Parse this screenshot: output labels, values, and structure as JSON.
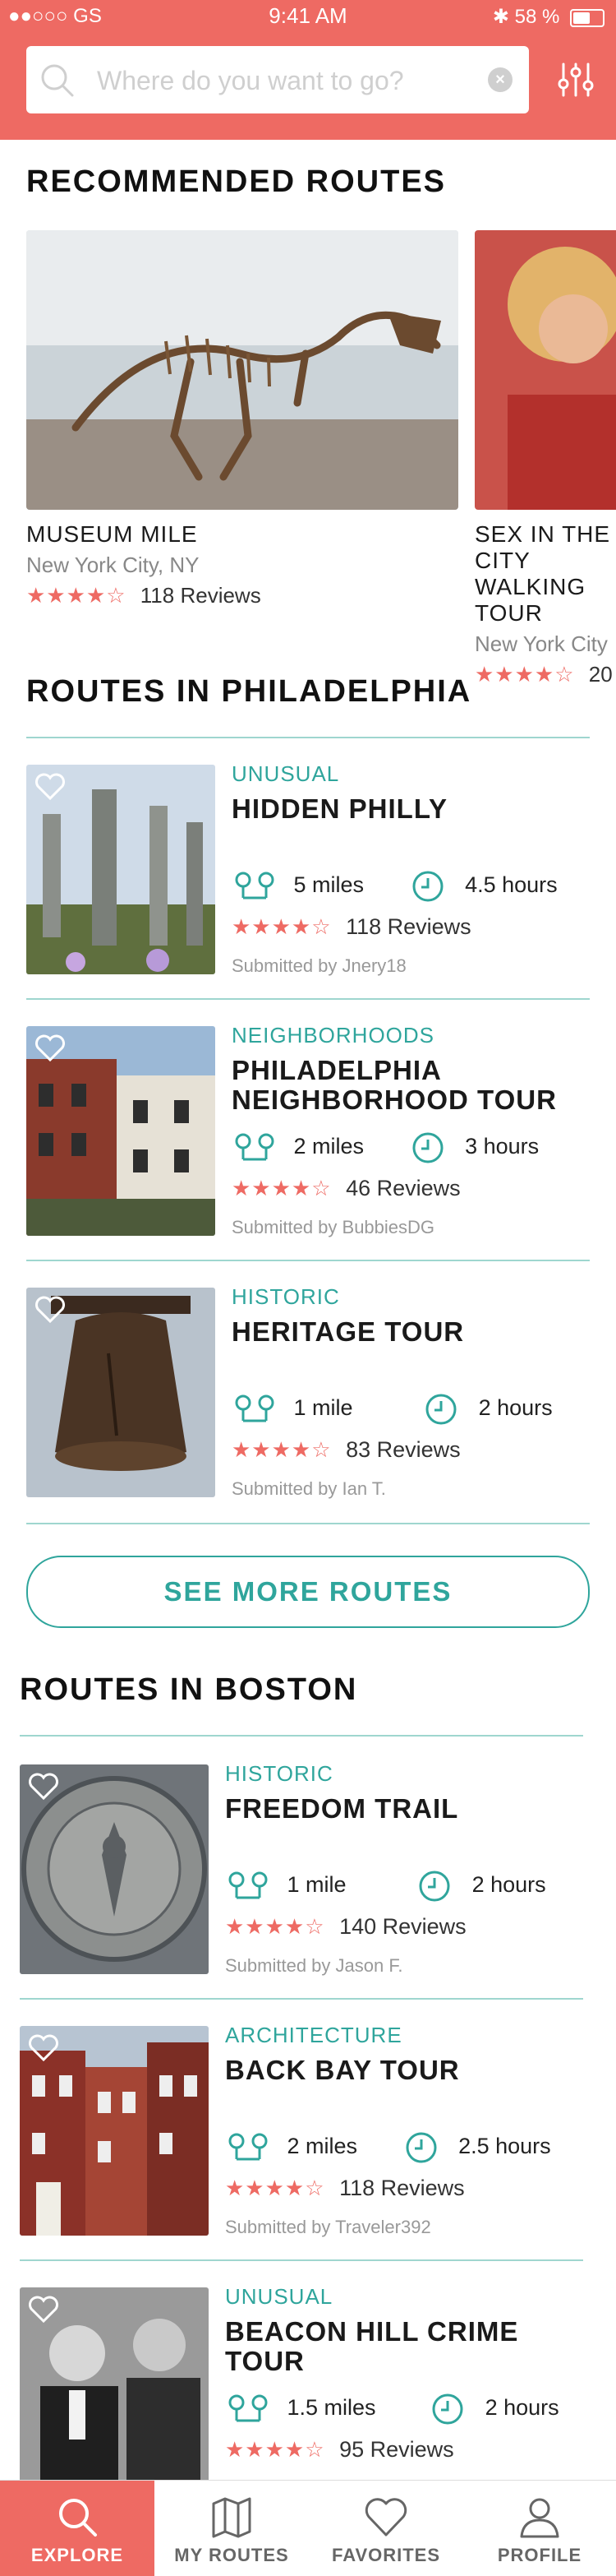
{
  "status": {
    "carrier": "●●○○○ GS",
    "time": "9:41 AM",
    "battery": "58 %",
    "battery_level": 0.58
  },
  "search": {
    "placeholder": "Where do you want to go?"
  },
  "recommended": {
    "heading": "RECOMMENDED ROUTES",
    "cards": [
      {
        "title": "MUSEUM MILE",
        "location": "New York City, NY",
        "stars": "★★★★☆",
        "reviews": "118 Reviews"
      },
      {
        "title": "SEX IN THE CITY WALKING TOUR",
        "location": "New York City",
        "stars": "★★★★☆",
        "reviews": "20"
      }
    ]
  },
  "philadelphia": {
    "heading": "ROUTES IN PHILADELPHIA",
    "routes": [
      {
        "category": "UNUSUAL",
        "name": "HIDDEN PHILLY",
        "distance": "5 miles",
        "duration": "4.5 hours",
        "stars": "★★★★☆",
        "reviews": "118 Reviews",
        "submitted": "Submitted by Jnery18"
      },
      {
        "category": "NEIGHBORHOODS",
        "name": "PHILADELPHIA NEIGHBORHOOD TOUR",
        "distance": "2 miles",
        "duration": "3 hours",
        "stars": "★★★★☆",
        "reviews": "46 Reviews",
        "submitted": "Submitted by BubbiesDG"
      },
      {
        "category": "HISTORIC",
        "name": "HERITAGE TOUR",
        "distance": "1 mile",
        "duration": "2 hours",
        "stars": "★★★★☆",
        "reviews": "83 Reviews",
        "submitted": "Submitted by Ian T."
      }
    ],
    "more_label": "SEE MORE ROUTES"
  },
  "boston": {
    "heading": "ROUTES IN BOSTON",
    "routes": [
      {
        "category": "HISTORIC",
        "name": "FREEDOM TRAIL",
        "distance": "1 mile",
        "duration": "2 hours",
        "stars": "★★★★☆",
        "reviews": "140 Reviews",
        "submitted": "Submitted by Jason F."
      },
      {
        "category": "ARCHITECTURE",
        "name": "BACK BAY TOUR",
        "distance": "2 miles",
        "duration": "2.5 hours",
        "stars": "★★★★☆",
        "reviews": "118 Reviews",
        "submitted": "Submitted by Traveler392"
      },
      {
        "category": "UNUSUAL",
        "name": "BEACON HILL CRIME TOUR",
        "distance": "1.5 miles",
        "duration": "2 hours",
        "stars": "★★★★☆",
        "reviews": "95 Reviews",
        "submitted": ""
      }
    ]
  },
  "tabs": {
    "explore": "EXPLORE",
    "my_routes": "MY ROUTES",
    "favorites": "FAVORITES",
    "profile": "PROFILE"
  },
  "colors": {
    "accent": "#ee6a63",
    "teal": "#2fa59c"
  }
}
